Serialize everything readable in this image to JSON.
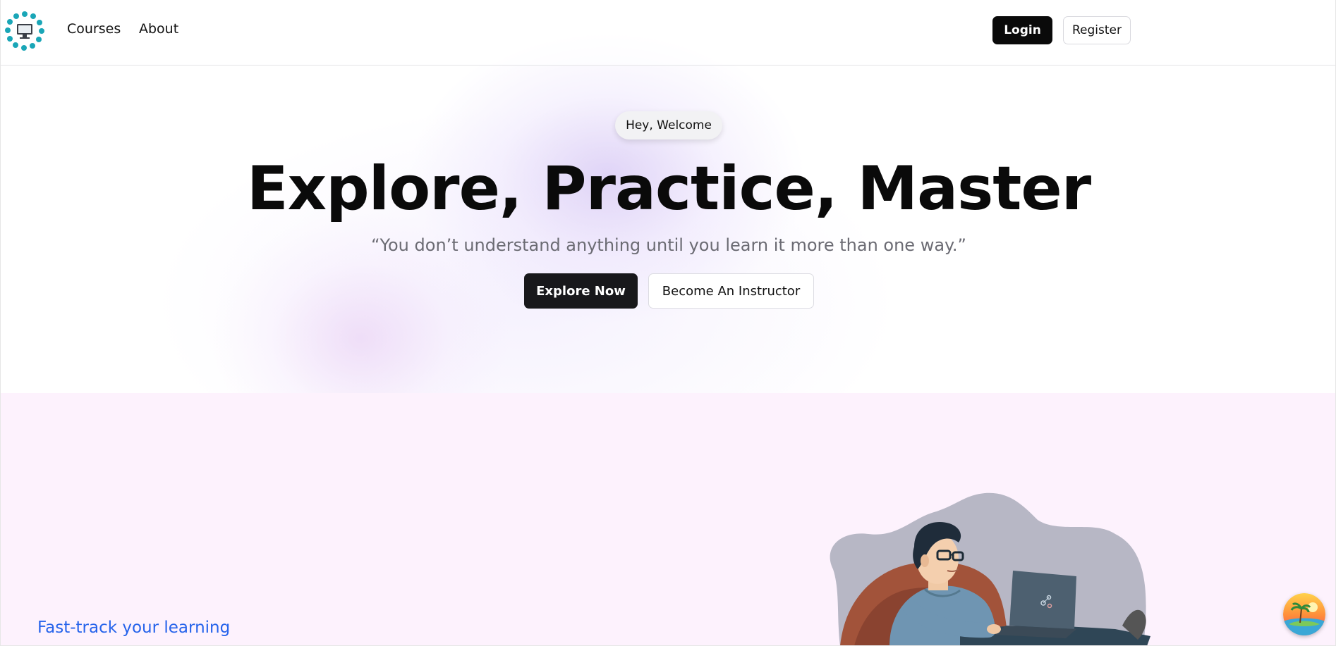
{
  "nav": {
    "links": [
      "Courses",
      "About"
    ],
    "login_label": "Login",
    "register_label": "Register"
  },
  "hero": {
    "badge": "Hey, Welcome",
    "title": "Explore, Practice, Master",
    "quote": "“You don’t understand anything until you learn it more than one way.”",
    "primary_cta": "Explore Now",
    "secondary_cta": "Become An Instructor"
  },
  "lower": {
    "tagline": "Fast-track your learning"
  },
  "icons": {
    "logo": "logo-icon",
    "illustration": "person-with-laptop-illustration",
    "fab": "island-sunset-icon"
  },
  "colors": {
    "primary_dark": "#0a0a0a",
    "link_blue": "#2563eb",
    "lower_bg": "#fdf2fd",
    "quote_gray": "#6b6b73"
  }
}
